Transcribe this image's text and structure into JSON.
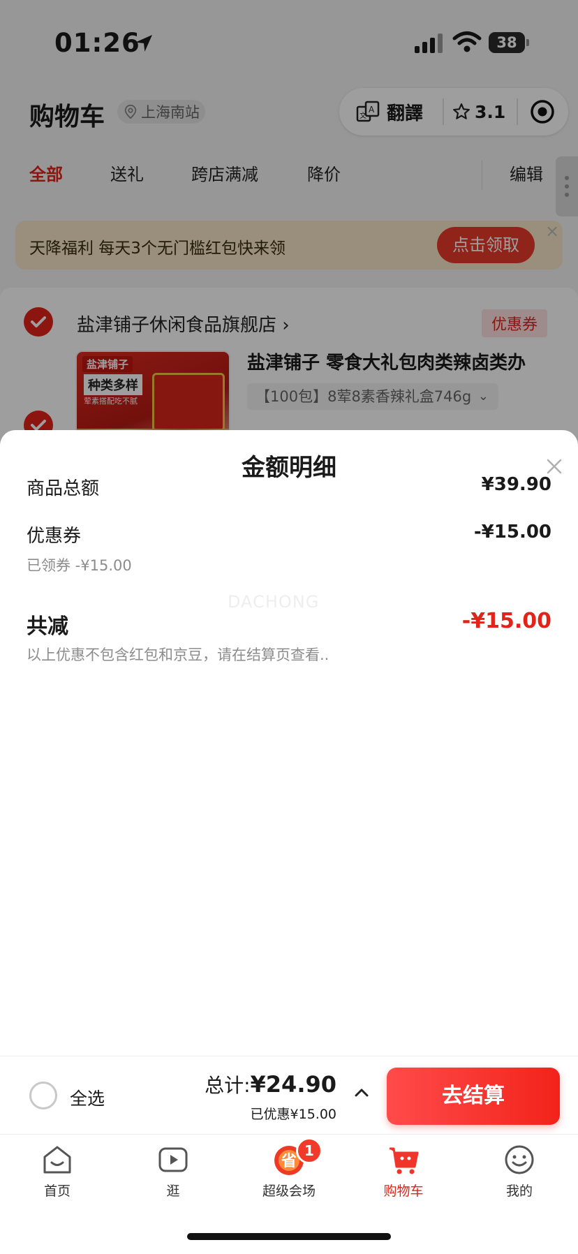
{
  "status_bar": {
    "time": "01:26",
    "battery": "38"
  },
  "header": {
    "title": "购物车",
    "location": "上海南站"
  },
  "mini_capsule": {
    "translate_label": "翻譯",
    "rating": "3.1"
  },
  "tabs": [
    {
      "label": "全部",
      "active": true
    },
    {
      "label": "送礼",
      "active": false
    },
    {
      "label": "跨店满减",
      "active": false
    },
    {
      "label": "降价",
      "active": false
    }
  ],
  "edit_label": "编辑",
  "banner": {
    "text": "天降福利 每天3个无门槛红包快来领",
    "button": "点击领取"
  },
  "store": {
    "name": "盐津铺子休闲食品旗舰店 ›",
    "coupon_tag": "优惠券",
    "product_title": "盐津铺子 零食大礼包肉类辣卤类办",
    "product_spec": "【100包】8荤8素香辣礼盒746g",
    "image_brand": "盐津铺子",
    "image_text_1": "种类多样",
    "image_text_2": "荤素搭配吃不腻"
  },
  "sheet": {
    "title": "金额明细",
    "goods_total_label": "商品总额",
    "goods_total_value": "¥39.90",
    "coupon_label": "优惠券",
    "coupon_value": "-¥15.00",
    "coupon_note": "已领券 -¥15.00",
    "watermark": "DACHONG",
    "total_discount_label": "共减",
    "total_discount_value": "-¥15.00",
    "disclaimer": "以上优惠不包含红包和京豆，请在结算页查看.."
  },
  "checkout": {
    "select_all": "全选",
    "total_prefix": "总计:",
    "total_amount": "¥24.90",
    "saved": "已优惠¥15.00",
    "button": "去结算"
  },
  "tab_bar": [
    {
      "label": "首页",
      "icon": "home-icon"
    },
    {
      "label": "逛",
      "icon": "play-icon"
    },
    {
      "label": "超级会场",
      "icon": "super-venue-icon",
      "badge": "1"
    },
    {
      "label": "购物车",
      "icon": "cart-icon",
      "active": true
    },
    {
      "label": "我的",
      "icon": "smiley-icon"
    }
  ],
  "colors": {
    "accent": "#e2231a",
    "overlay": "rgba(0,0,0,0.38)"
  }
}
